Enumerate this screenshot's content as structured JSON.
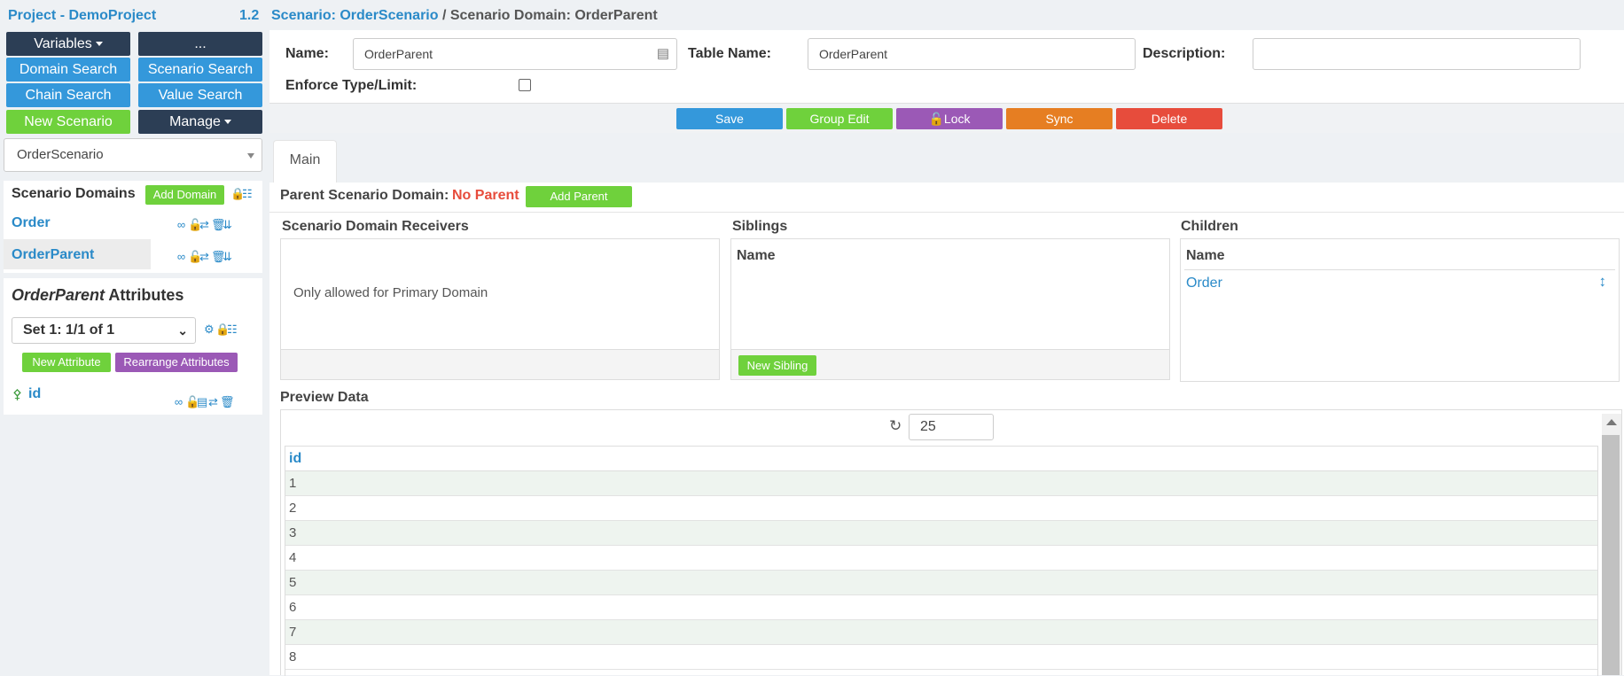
{
  "sidebar": {
    "project_title": "Project - DemoProject",
    "project_version": "1.2",
    "buttons": {
      "variables": "Variables",
      "more": "...",
      "domain_search": "Domain Search",
      "scenario_search": "Scenario Search",
      "chain_search": "Chain Search",
      "value_search": "Value Search",
      "new_scenario": "New Scenario",
      "manage": "Manage"
    },
    "scenario_select": "OrderScenario",
    "scenario_domains": {
      "title": "Scenario Domains",
      "add_label": "Add Domain",
      "items": [
        {
          "label": "Order"
        },
        {
          "label": "OrderParent"
        }
      ]
    },
    "attributes": {
      "title_italic": "OrderParent",
      "title_rest": " Attributes",
      "set_select": "Set 1: 1/1 of 1",
      "new_attribute": "New Attribute",
      "rearrange": "Rearrange Attributes",
      "items": [
        {
          "label": "id"
        }
      ]
    }
  },
  "breadcrumb": {
    "scenario": "Scenario: OrderScenario",
    "separator": " / ",
    "domain": "Scenario Domain: OrderParent"
  },
  "form": {
    "name_label": "Name:",
    "name_value": "OrderParent",
    "table_label": "Table Name:",
    "table_value": "OrderParent",
    "description_label": "Description:",
    "description_value": "",
    "enforce_label": "Enforce Type/Limit:"
  },
  "actions": {
    "save": "Save",
    "group_edit": "Group Edit",
    "lock": "Lock",
    "sync": "Sync",
    "delete": "Delete"
  },
  "tabs": [
    {
      "label": "Main"
    }
  ],
  "parent": {
    "label": "Parent Scenario Domain:",
    "value": "No Parent",
    "add_label": "Add Parent"
  },
  "receivers": {
    "title": "Scenario Domain Receivers",
    "message": "Only allowed for Primary Domain"
  },
  "siblings": {
    "title": "Siblings",
    "header": "Name",
    "new_label": "New Sibling"
  },
  "children": {
    "title": "Children",
    "header": "Name",
    "items": [
      {
        "label": "Order"
      }
    ]
  },
  "preview": {
    "title": "Preview Data",
    "limit": "25",
    "column": "id",
    "rows": [
      "1",
      "2",
      "3",
      "4",
      "5",
      "6",
      "7",
      "8"
    ]
  },
  "colors": {
    "dark": "#2c3e55",
    "blue": "#3498db",
    "green": "#6fd13c",
    "purple": "#9b59b6",
    "orange": "#e67e22",
    "red": "#e74c3c",
    "link": "#2a8ac8"
  }
}
